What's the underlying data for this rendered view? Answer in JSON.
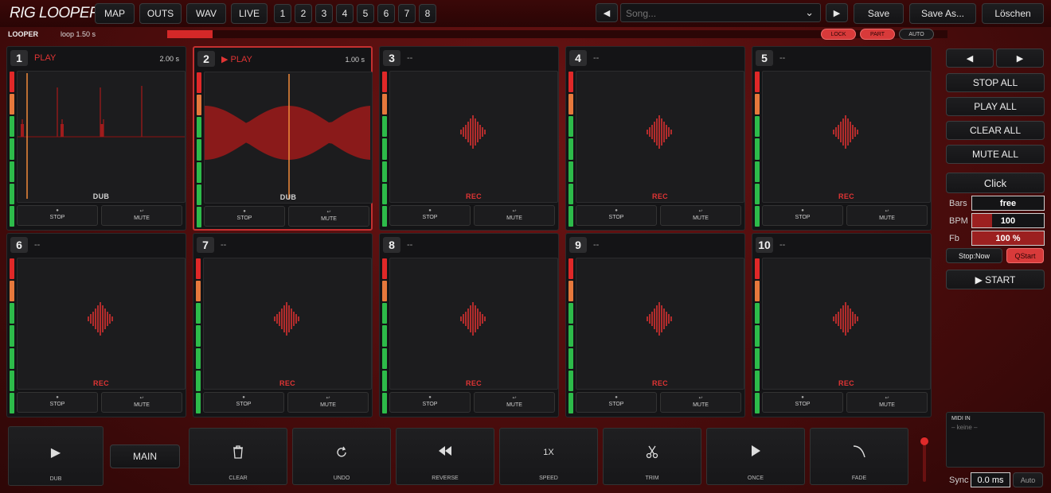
{
  "app": {
    "title": "RIG LOOPER"
  },
  "topnav": {
    "map": "MAP",
    "outs": "OUTS",
    "wav": "WAV",
    "live": "LIVE"
  },
  "bank_numbers": [
    "1",
    "2",
    "3",
    "4",
    "5",
    "6",
    "7",
    "8"
  ],
  "song": {
    "placeholder": "Song...",
    "prev_icon": "◀",
    "next_icon": "▶",
    "chevron": "⌄",
    "save": "Save",
    "save_as": "Save As...",
    "delete": "Löschen"
  },
  "looper": {
    "label": "LOOPER",
    "loop_length": "loop 1.50 s",
    "progress_fraction": 0.058,
    "lock": "LOCK",
    "part": "PART",
    "auto": "AUTO"
  },
  "track_buttons": {
    "stop": "STOP",
    "mute": "MUTE",
    "stop_icon": "●",
    "mute_icon": "↩"
  },
  "tracks": [
    {
      "num": "1",
      "state": "PLAY",
      "duration": "2.00 s",
      "wave": "dub1",
      "label": "DUB"
    },
    {
      "num": "2",
      "state": "▶ PLAY",
      "duration": "1.00 s",
      "wave": "dub2",
      "label": "DUB"
    },
    {
      "num": "3",
      "state": "--",
      "duration": "",
      "wave": "empty",
      "label": "REC"
    },
    {
      "num": "4",
      "state": "--",
      "duration": "",
      "wave": "empty",
      "label": "REC"
    },
    {
      "num": "5",
      "state": "--",
      "duration": "",
      "wave": "empty",
      "label": "REC"
    },
    {
      "num": "6",
      "state": "--",
      "duration": "",
      "wave": "empty",
      "label": "REC"
    },
    {
      "num": "7",
      "state": "--",
      "duration": "",
      "wave": "empty",
      "label": "REC"
    },
    {
      "num": "8",
      "state": "--",
      "duration": "",
      "wave": "empty",
      "label": "REC"
    },
    {
      "num": "9",
      "state": "--",
      "duration": "",
      "wave": "empty",
      "label": "REC"
    },
    {
      "num": "10",
      "state": "--",
      "duration": "",
      "wave": "empty",
      "label": "REC"
    }
  ],
  "right": {
    "prev": "◀",
    "next": "▶",
    "stop_all": "STOP ALL",
    "play_all": "PLAY ALL",
    "clear_all": "CLEAR ALL",
    "mute_all": "MUTE ALL",
    "click": "Click",
    "bars_label": "Bars",
    "bars_value": "free",
    "bpm_label": "BPM",
    "bpm_value": "100",
    "bpm_fill_fraction": 0.28,
    "fb_label": "Fb",
    "fb_value": "100 %",
    "fb_fill_fraction": 1.0,
    "stop_now": "Stop:Now",
    "qstart": "QStart",
    "start": "▶ START",
    "midi_in_title": "MIDI IN",
    "midi_in_value": "– keine –",
    "sync_label": "Sync",
    "sync_value": "0.0 ms",
    "sync_auto": "Auto"
  },
  "bottom": {
    "dub_label": "DUB",
    "dub_icon": "▶",
    "main": "MAIN",
    "clear": "CLEAR",
    "undo": "UNDO",
    "reverse": "REVERSE",
    "speed": "SPEED",
    "speed_icon": "1X",
    "trim": "TRIM",
    "once": "ONCE",
    "fade": "FADE",
    "volume_fraction": 0.88
  },
  "colors": {
    "accent": "#d42828",
    "meter_red": "#e02828",
    "meter_orange": "#e6783c",
    "meter_green": "#2dbb4a"
  }
}
